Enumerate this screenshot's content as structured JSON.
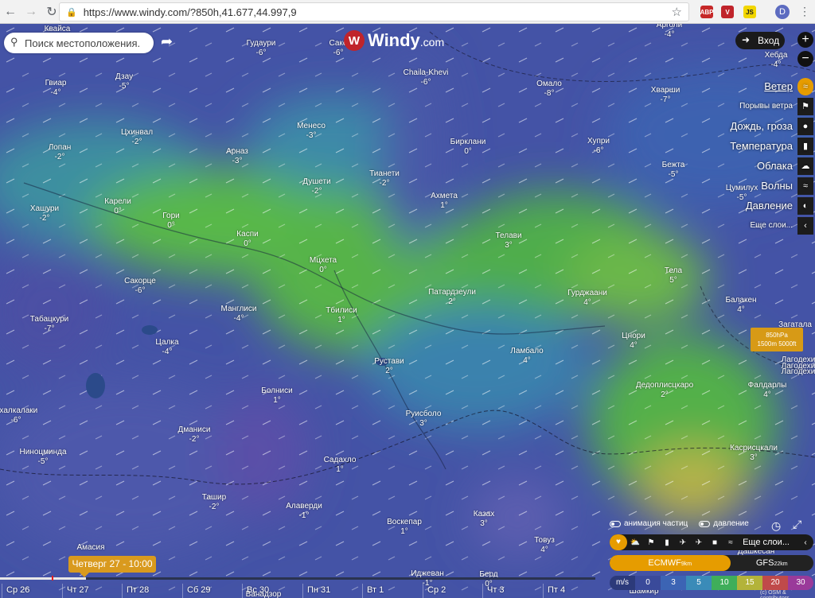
{
  "browser": {
    "url": "https://www.windy.com/?850h,41.677,44.997,9",
    "back_icon": "arrow-left",
    "forward_icon": "arrow-right",
    "reload_icon": "reload",
    "home_icon": "home",
    "extensions": [
      "ABP",
      "V",
      "JS"
    ],
    "profile_initial": "D"
  },
  "app": {
    "logo_main": "Windy",
    "logo_suffix": ".com",
    "search_placeholder": "Поиск местоположения.",
    "login_label": "Вход"
  },
  "layers": [
    {
      "label": "Ветер",
      "active": true,
      "icon": "wind"
    },
    {
      "label": "Порывы ветра",
      "small": true,
      "icon": "flag"
    },
    {
      "label": "Дождь, гроза",
      "icon": "drop"
    },
    {
      "label": "Температура",
      "icon": "thermometer"
    },
    {
      "label": "Облака",
      "icon": "cloud"
    },
    {
      "label": "Волны",
      "icon": "waves"
    },
    {
      "label": "Давление",
      "icon": "gauge"
    },
    {
      "label": "Еще слои...",
      "small": true,
      "icon": "chevron-left"
    }
  ],
  "pressure_level": {
    "line1": "850hPa",
    "line2": "1500m 5000ft"
  },
  "places": [
    {
      "name": "Квайса",
      "temp": ""
    },
    {
      "name": "Гудаури",
      "temp": "-6°"
    },
    {
      "name": "Саке",
      "temp": "-6°"
    },
    {
      "name": "Арголи",
      "temp": "-4°"
    },
    {
      "name": "Хебда",
      "temp": "-4°"
    },
    {
      "name": "Гвиар",
      "temp": "-4°"
    },
    {
      "name": "Дзау",
      "temp": "-5°"
    },
    {
      "name": "Chaila-Khevi",
      "temp": "-6°"
    },
    {
      "name": "Омало",
      "temp": "-8°"
    },
    {
      "name": "Хварши",
      "temp": "-7°"
    },
    {
      "name": "Цхинвал",
      "temp": "-2°"
    },
    {
      "name": "Менесо",
      "temp": "-3°"
    },
    {
      "name": "Лопан",
      "temp": "-2°"
    },
    {
      "name": "Арназ",
      "temp": "-3°"
    },
    {
      "name": "Бирклани",
      "temp": "0°"
    },
    {
      "name": "Хупри",
      "temp": "-6°"
    },
    {
      "name": "Душети",
      "temp": "-2°"
    },
    {
      "name": "Тианети",
      "temp": "-2°"
    },
    {
      "name": "Бежта",
      "temp": "-5°"
    },
    {
      "name": "Ахмета",
      "temp": "1°"
    },
    {
      "name": "Цумилух",
      "temp": "-5°"
    },
    {
      "name": "Карели",
      "temp": "0°"
    },
    {
      "name": "Хашури",
      "temp": "-2°"
    },
    {
      "name": "Гори",
      "temp": "0°"
    },
    {
      "name": "Каспи",
      "temp": "0°"
    },
    {
      "name": "Телави",
      "temp": "3°"
    },
    {
      "name": "Мцхета",
      "temp": "0°"
    },
    {
      "name": "Тела",
      "temp": "5°"
    },
    {
      "name": "Сакорце",
      "temp": "-6°"
    },
    {
      "name": "Патардзеули",
      "temp": "2°"
    },
    {
      "name": "Гурджаани",
      "temp": "4°"
    },
    {
      "name": "Балакен",
      "temp": "4°"
    },
    {
      "name": "Тбилиси",
      "temp": "1°"
    },
    {
      "name": "Манглиси",
      "temp": "-4°"
    },
    {
      "name": "Табацкури",
      "temp": "-7°"
    },
    {
      "name": "Загатала",
      "temp": ""
    },
    {
      "name": "Цнори",
      "temp": "4°"
    },
    {
      "name": "Цалка",
      "temp": "-4°"
    },
    {
      "name": "Лагодехи",
      "temp": ""
    },
    {
      "name": "Лагодехи",
      "temp": ""
    },
    {
      "name": "Рустави",
      "temp": "2°"
    },
    {
      "name": "Лагодехи",
      "temp": ""
    },
    {
      "name": "Дедоплисцкаро",
      "temp": "2°"
    },
    {
      "name": "Фалдарлы",
      "temp": "4°"
    },
    {
      "name": "Ламбало",
      "temp": "4°"
    },
    {
      "name": "Ахалкалаки",
      "temp": "-6°"
    },
    {
      "name": "Болниси",
      "temp": "1°"
    },
    {
      "name": "Руисболо",
      "temp": "3°"
    },
    {
      "name": "Дманиси",
      "temp": "-2°"
    },
    {
      "name": "Касрисцкали",
      "temp": "3°"
    },
    {
      "name": "Ниноцминда",
      "temp": "-5°"
    },
    {
      "name": "Садахло",
      "temp": "1°"
    },
    {
      "name": "Ташир",
      "temp": "-2°"
    },
    {
      "name": "Алаверди",
      "temp": "-1°"
    },
    {
      "name": "Казах",
      "temp": "3°"
    },
    {
      "name": "Воскепар",
      "temp": "1°"
    },
    {
      "name": "Товуз",
      "temp": "4°"
    },
    {
      "name": "Амасия",
      "temp": ""
    },
    {
      "name": "Иджеван",
      "temp": "-1°"
    },
    {
      "name": "Берд",
      "temp": "0°"
    },
    {
      "name": "Дашкесан",
      "temp": ""
    },
    {
      "name": "Шамкир",
      "temp": ""
    },
    {
      "name": "Ванадзор",
      "temp": ""
    }
  ],
  "bottom_panel": {
    "particles_label": "анимация частиц",
    "pressure_label": "давление",
    "more_layers": "Еще слои...",
    "models": [
      {
        "name": "ECMWF",
        "res": "9km",
        "active": true
      },
      {
        "name": "GFS",
        "res": "22km",
        "active": false
      }
    ],
    "scale_unit": "m/s",
    "scale_values": [
      "0",
      "3",
      "5",
      "10",
      "15",
      "20",
      "30"
    ],
    "scale_colors": [
      "#3a4a9a",
      "#3c64b4",
      "#3a8bb8",
      "#3fae5a",
      "#b3b33a",
      "#c04a4a",
      "#9a3a9a"
    ],
    "credit": "(c) OSM & contributors"
  },
  "timeline": {
    "current": "Четверг 27 - 10:00",
    "days": [
      "Ср 26",
      "Чт 27",
      "Пт 28",
      "Сб 29",
      "Вс 30",
      "Пн 31",
      "Вт 1",
      "Ср 2",
      "Чт 3",
      "Пт 4"
    ]
  }
}
